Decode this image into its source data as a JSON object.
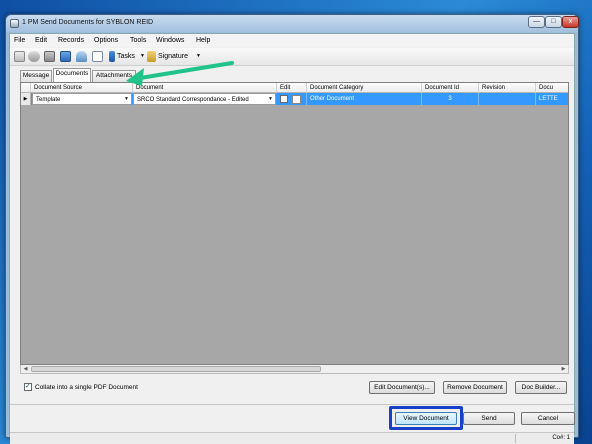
{
  "window": {
    "title": "1 PM Send Documents for SYBLON REID",
    "controls": {
      "minimize": "—",
      "maximize": "□",
      "close": "x"
    }
  },
  "menu": [
    "File",
    "Edit",
    "Records",
    "Options",
    "Tools",
    "Windows",
    "Help"
  ],
  "toolbar": {
    "tasks_label": "Tasks",
    "signature_label": "Signature"
  },
  "tabs": [
    {
      "label": "Message",
      "active": false
    },
    {
      "label": "Documents",
      "active": true
    },
    {
      "label": "Attachments",
      "active": false
    }
  ],
  "grid": {
    "columns": [
      "Document Source",
      "Document",
      "Edit",
      "Document Category",
      "Document Id",
      "Revision",
      "Docu"
    ],
    "rows": [
      {
        "source": "Template",
        "document": "SRCO Standard Correspondance - Edited",
        "edit": false,
        "category": "Other Document",
        "id": "3",
        "revision": "",
        "extra": "LETTE"
      }
    ]
  },
  "collate": {
    "label": "Collate into a single PDF Document",
    "checked": true
  },
  "buttons": {
    "edit_documents": "Edit Document(s)...",
    "remove_document": "Remove Document",
    "doc_builder": "Doc Builder...",
    "view_document": "View Document",
    "send": "Send",
    "cancel": "Cancel"
  },
  "status": {
    "company": "Co#: 1"
  },
  "colors": {
    "selection": "#3399ff",
    "annotation_arrow": "#22c38a",
    "annotation_box": "#1840c8"
  }
}
